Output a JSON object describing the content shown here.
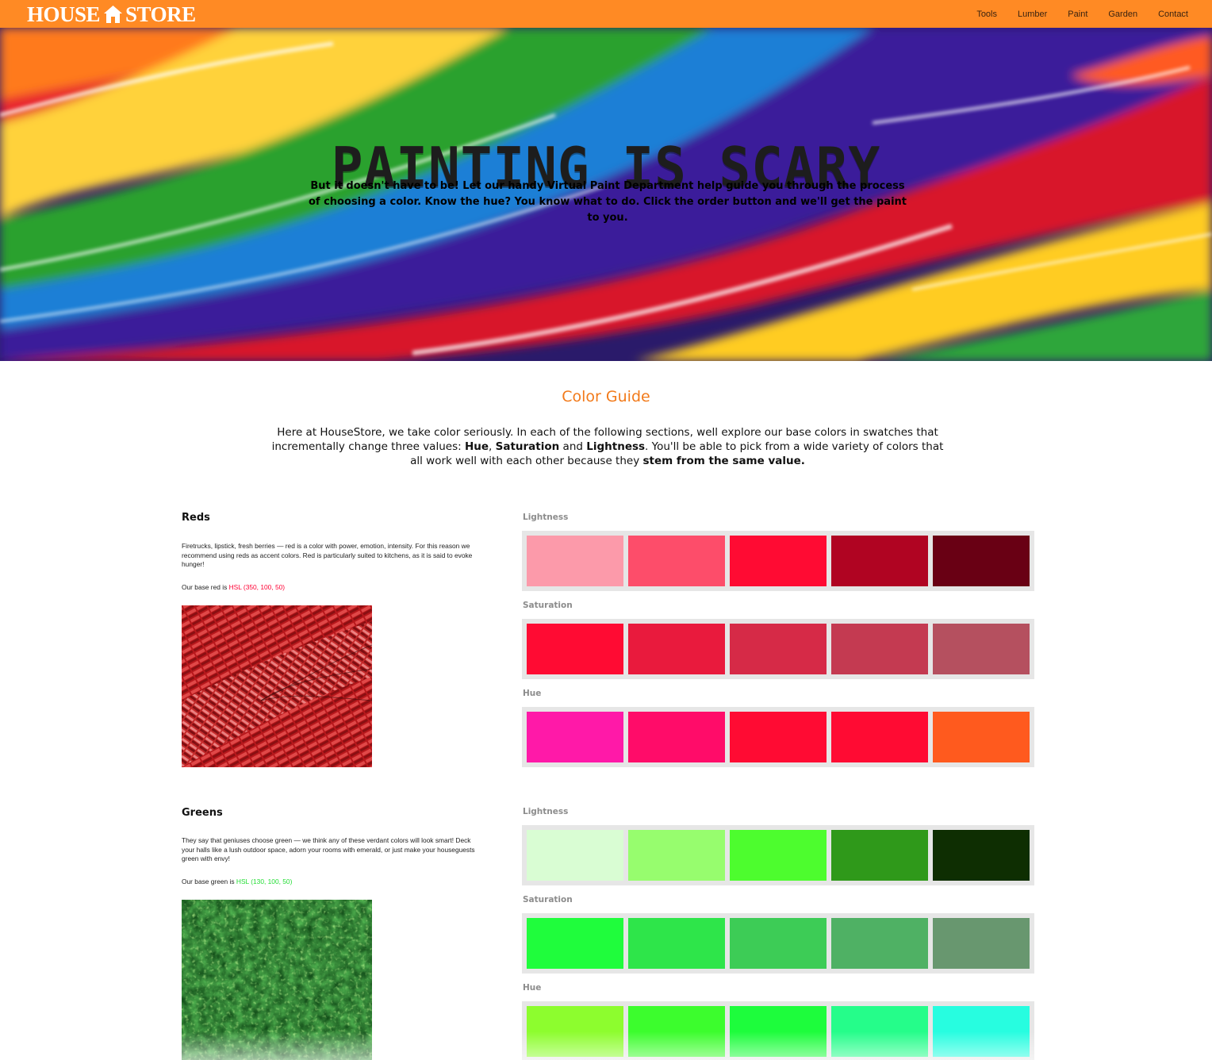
{
  "header": {
    "logo_left": "HOUSE",
    "logo_right": "STORE",
    "logo_icon": "house-icon",
    "nav": [
      "Tools",
      "Lumber",
      "Paint",
      "Garden",
      "Contact"
    ]
  },
  "hero": {
    "title": "PAINTING IS SCARY",
    "text": "But it doesn't have to be! Let our handy Virtual Paint Department help guide you through the process of choosing a color. Know the hue? You know what to do. Click the order button and we'll get the paint to you."
  },
  "intro": {
    "title": "Color Guide",
    "part1": "Here at HouseStore, we take color seriously. In each of the following sections, well explore our base colors in swatches that incrementally change three values: ",
    "hue": "Hue",
    "comma": ", ",
    "saturation": "Saturation",
    "and": " and ",
    "lightness": "Lightness",
    "part2": ". You'll be able to pick from a wide variety of colors that all work well with each other because they ",
    "stem": "stem from the same value."
  },
  "sections": {
    "reds": {
      "title": "Reds",
      "description": "Firetrucks, lipstick, fresh berries — red is a color with power, emotion, intensity. For this reason we recommend using reds as accent colors. Red is particularly suited to kitchens, as it is said to evoke hunger!",
      "base_prefix": "Our base red is ",
      "base_value": "HSL (350, 100, 50)",
      "base_color": "#ff0033",
      "labels": {
        "lightness": "Lightness",
        "saturation": "Saturation",
        "hue": "Hue"
      },
      "lightness": [
        "#fc9aaa",
        "#fd4d6a",
        "#ff0b33",
        "#b00422",
        "#690014"
      ],
      "saturation": [
        "#ff0b33",
        "#e91a3d",
        "#d62a47",
        "#c43a51",
        "#b5505f"
      ],
      "hue": [
        "#ff19a8",
        "#ff0c69",
        "#ff0b33",
        "#ff0b33",
        "#ff5a1e"
      ]
    },
    "greens": {
      "title": "Greens",
      "description": "They say that geniuses choose green — we think any of these verdant colors will look smart! Deck your halls like a lush outdoor space, adorn your rooms with emerald, or just make your houseguests green with envy!",
      "base_prefix": "Our base green is ",
      "base_value": "HSL (130, 100, 50)",
      "base_color": "#22dd33",
      "labels": {
        "lightness": "Lightness",
        "saturation": "Saturation",
        "hue": "Hue"
      },
      "lightness": [
        "#d9fdd3",
        "#97fd6e",
        "#4dfd2e",
        "#2f991a",
        "#0e2e02"
      ],
      "saturation": [
        "#1ffd3c",
        "#2ee54a",
        "#3dcc56",
        "#4fb164",
        "#68976f"
      ],
      "hue": [
        "#8dfd2e",
        "#3cfd2d",
        "#1dfd3c",
        "#25fd8a",
        "#27fde0"
      ]
    }
  }
}
